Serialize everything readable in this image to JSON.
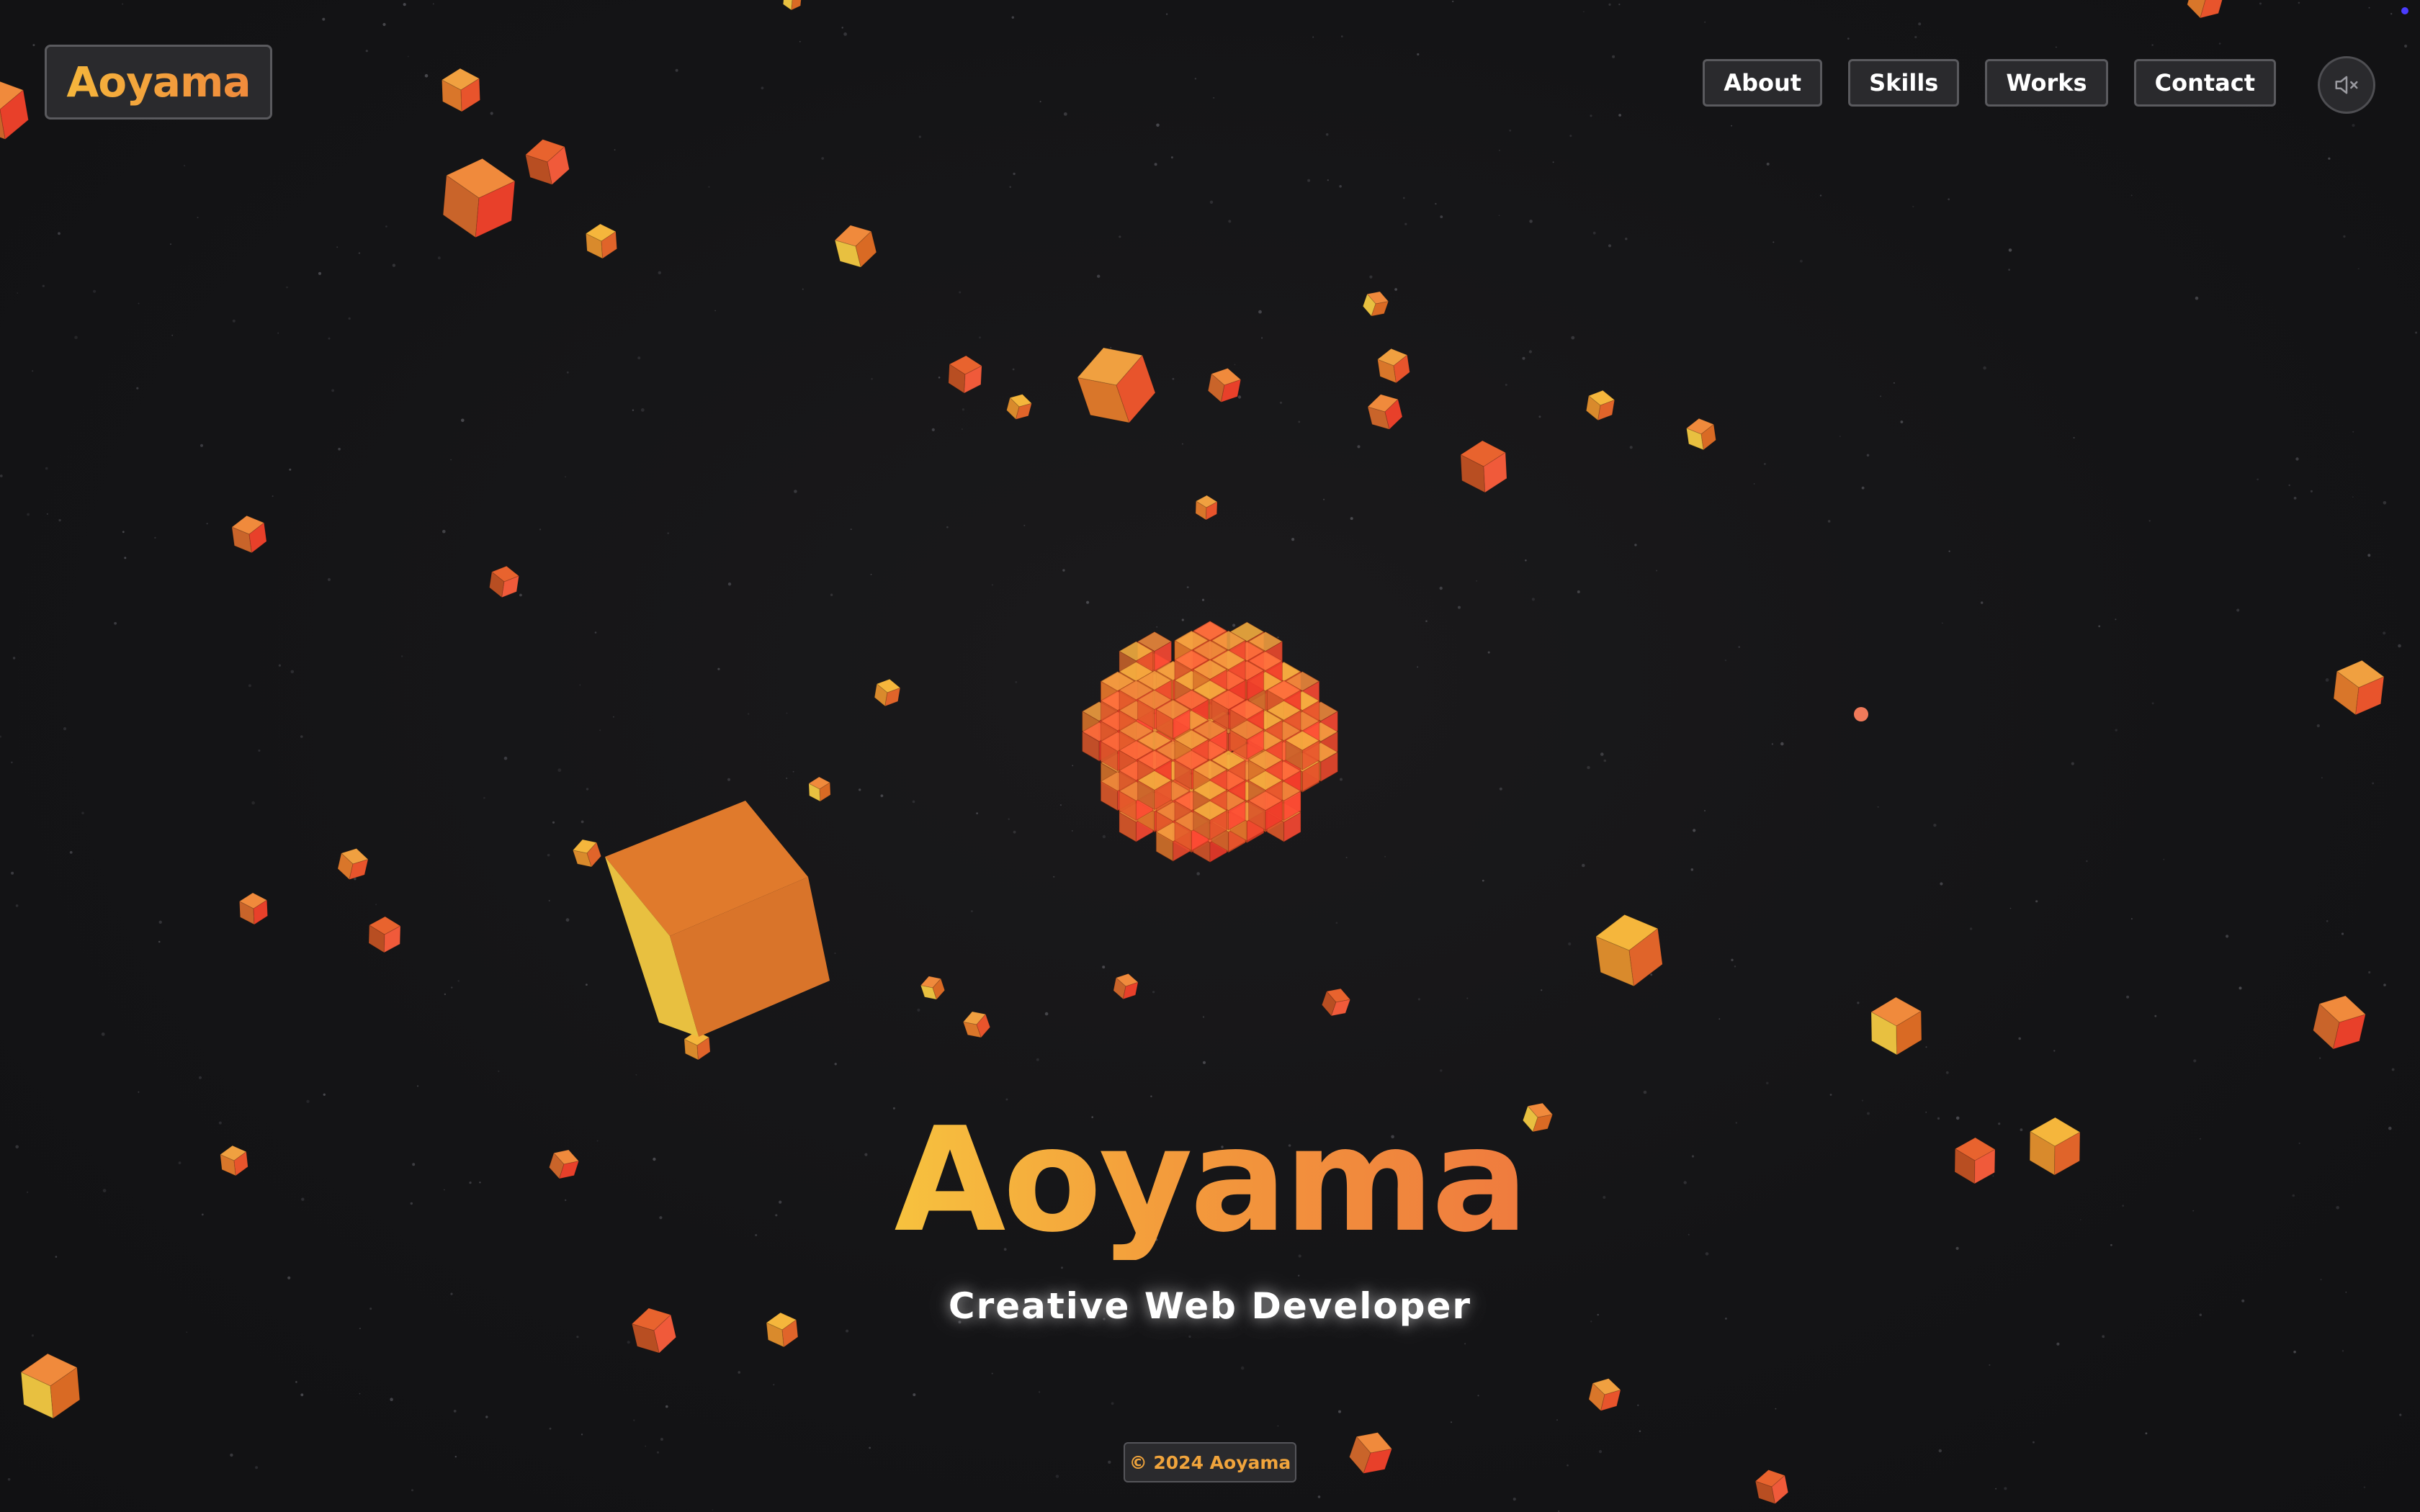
{
  "header": {
    "logo": "Aoyama",
    "nav": [
      {
        "id": "about",
        "label": "About"
      },
      {
        "id": "skills",
        "label": "Skills"
      },
      {
        "id": "works",
        "label": "Works"
      },
      {
        "id": "contact",
        "label": "Contact"
      }
    ],
    "mute_icon": "speaker-muted-icon"
  },
  "hero": {
    "title": "Aoyama",
    "subtitle": "Creative Web Developer"
  },
  "footer": {
    "copyright": "© 2024 Aoyama"
  },
  "theme": {
    "background": "#141416",
    "accent_gold": "#f5b63c",
    "accent_orange": "#f08a3c",
    "cube_red": "#e8402a",
    "button_bg": "#2a2a2d",
    "button_border": "#5a5a5e"
  },
  "scene": {
    "object": "3D cube cluster with floating cubes",
    "cube_palette": [
      "#f39a3c",
      "#e8632e",
      "#e8402a",
      "#d96a24",
      "#f0c040"
    ]
  }
}
